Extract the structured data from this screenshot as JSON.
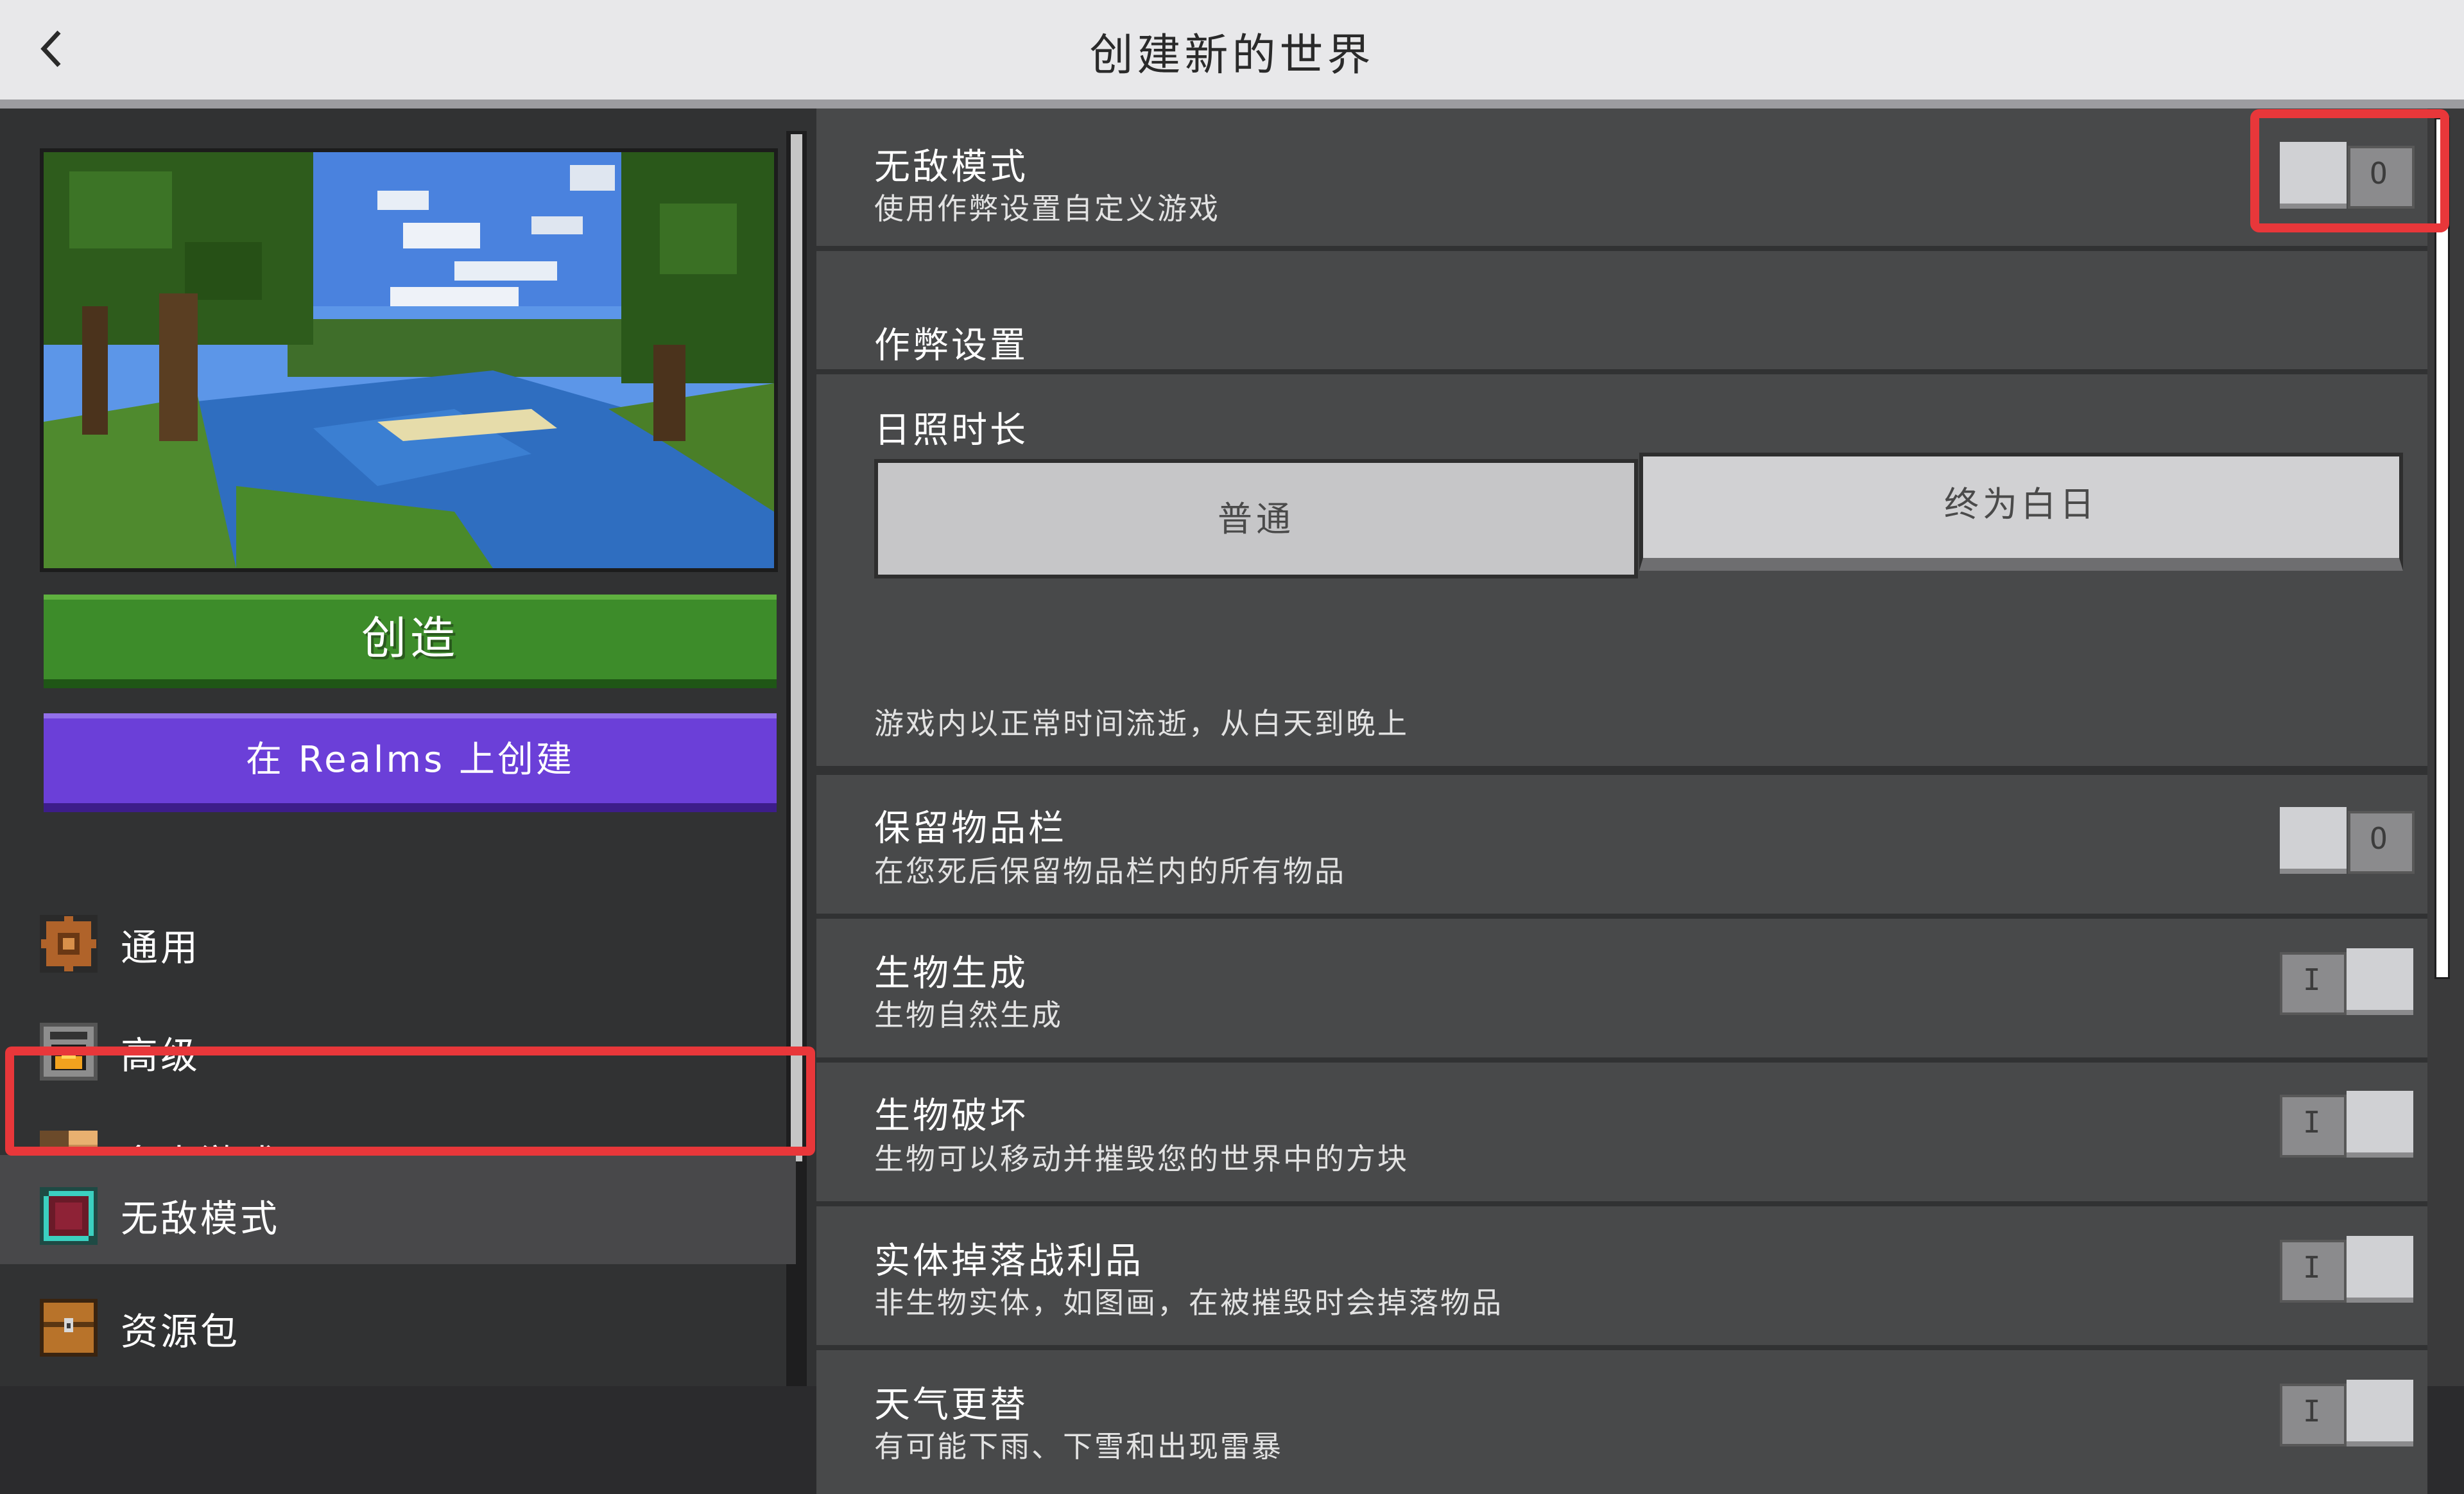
{
  "header": {
    "title": "创建新的世界",
    "back_icon": "chevron-left-icon"
  },
  "left": {
    "create_label": "创造",
    "realms_label": "在 Realms 上创建",
    "nav": [
      {
        "label": "通用",
        "icon": "gear-icon"
      },
      {
        "label": "高级",
        "icon": "furnace-icon"
      },
      {
        "label": "多人游戏",
        "icon": "players-icon"
      },
      {
        "label": "无敌模式",
        "icon": "cheat-block-icon",
        "selected": true
      },
      {
        "label": "资源包",
        "icon": "chest-icon"
      }
    ]
  },
  "right": {
    "cheats_mode": {
      "title": "无敌模式",
      "desc": "使用作弊设置自定义游戏",
      "state": "off"
    },
    "section_header": "作弊设置",
    "daylight": {
      "title": "日照时长",
      "options": [
        "普通",
        "终为白日"
      ],
      "selected": "普通",
      "desc": "游戏内以正常时间流逝，从白天到晚上"
    },
    "settings": [
      {
        "title": "保留物品栏",
        "desc": "在您死后保留物品栏内的所有物品",
        "state": "off"
      },
      {
        "title": "生物生成",
        "desc": "生物自然生成",
        "state": "on"
      },
      {
        "title": "生物破坏",
        "desc": "生物可以移动并摧毁您的世界中的方块",
        "state": "on"
      },
      {
        "title": "实体掉落战利品",
        "desc": "非生物实体，如图画，在被摧毁时会掉落物品",
        "state": "on"
      },
      {
        "title": "天气更替",
        "desc": "有可能下雨、下雪和出现雷暴",
        "state": "on"
      }
    ]
  },
  "colors": {
    "create_button": "#3d8c2a",
    "realms_button": "#6b3fd8",
    "highlight": "#e8373a"
  }
}
